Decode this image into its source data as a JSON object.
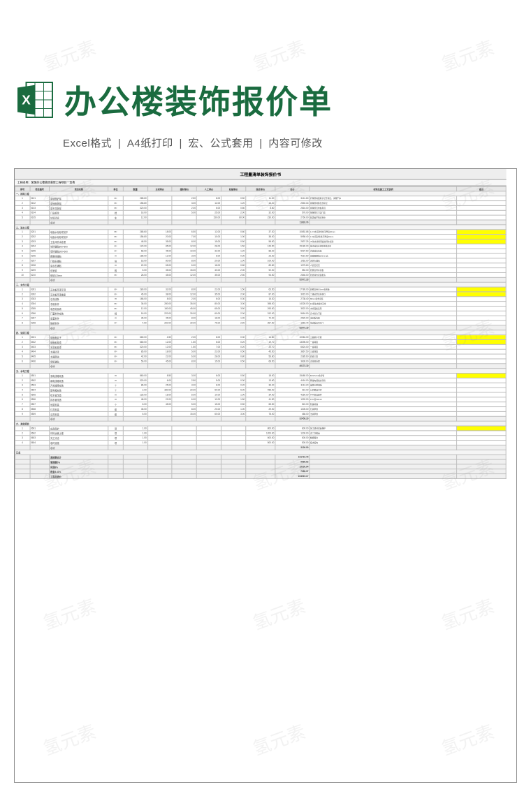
{
  "header": {
    "title": "办公楼装饰报价单",
    "subtitle_parts": [
      "Excel格式",
      "A4纸打印",
      "宏、公式套用",
      "内容可修改"
    ]
  },
  "watermark_text": "氢元素",
  "sheet": {
    "main_title": "工程量清单装饰报价书",
    "project_line": "工程名称：某某办公楼装饰装修工程项目一览表",
    "columns": [
      "序号",
      "项目编号",
      "项目名称",
      "单位",
      "数量",
      "主材单价",
      "辅材单价",
      "人工单价",
      "机械单价",
      "综合单价",
      "合价",
      "材料及施工工艺说明",
      "备注"
    ]
  },
  "sections": [
    {
      "name": "一、拆除工程",
      "rows": [
        [
          "1",
          "0101",
          "原墙面铲除",
          "m²",
          "285.60",
          "",
          "2.50",
          "8.00",
          "0.50",
          "11.00",
          "3141.60",
          "铲除原墙面腻子层至基层，清理干净",
          ""
        ],
        [
          "2",
          "0102",
          "原地面拆除",
          "m²",
          "156.80",
          "",
          "3.00",
          "12.00",
          "1.20",
          "16.20",
          "2540.16",
          "拆除原地砖及找平层",
          ""
        ],
        [
          "3",
          "0103",
          "原天花拆除",
          "m²",
          "320.00",
          "",
          "2.00",
          "6.00",
          "0.80",
          "8.80",
          "2816.00",
          "拆除原石膏板吊顶",
          ""
        ],
        [
          "4",
          "0104",
          "门窗拆除",
          "樘",
          "18.00",
          "",
          "5.00",
          "25.00",
          "2.00",
          "32.00",
          "576.00",
          "拆除原木门含门套",
          ""
        ],
        [
          "5",
          "0105",
          "垃圾清运",
          "车",
          "12.00",
          "",
          "",
          "150.00",
          "80.00",
          "230.00",
          "2760.00",
          "装袋运至指定地点",
          ""
        ],
        [
          "",
          "",
          "小计",
          "",
          "",
          "",
          "",
          "",
          "",
          "",
          "11833.76",
          "",
          ""
        ]
      ]
    },
    {
      "name": "二、泥水工程",
      "sep": "purple",
      "rows": [
        [
          "1",
          "0201",
          "墙面水泥砂浆找平",
          "m²",
          "285.60",
          "18.00",
          "6.50",
          "12.00",
          "0.80",
          "37.30",
          "10652.88",
          "1:2.5水泥砂浆找平厚度20mm",
          "hl"
        ],
        [
          "2",
          "0202",
          "地面水泥砂浆找平",
          "m²",
          "156.80",
          "20.00",
          "7.00",
          "10.00",
          "1.00",
          "38.00",
          "5958.40",
          "1:3水泥砂浆找平厚度30mm",
          "hl"
        ],
        [
          "3",
          "0203",
          "卫生间防水处理",
          "m²",
          "48.50",
          "35.00",
          "8.00",
          "15.00",
          "0.50",
          "58.50",
          "2837.25",
          "JS防水涂料两遍含闭水试验",
          "hl"
        ],
        [
          "4",
          "0204",
          "地砖铺贴800×800",
          "m²",
          "120.00",
          "85.00",
          "12.00",
          "28.00",
          "1.50",
          "126.50",
          "15180.00",
          "抛光砖含水泥砂浆结合层",
          ""
        ],
        [
          "5",
          "0205",
          "墙砖铺贴300×600",
          "m²",
          "68.00",
          "45.00",
          "10.00",
          "32.00",
          "1.20",
          "88.20",
          "5997.60",
          "内墙砖含勾缝",
          ""
        ],
        [
          "6",
          "0206",
          "踢脚线铺贴",
          "m",
          "185.00",
          "12.00",
          "3.00",
          "8.00",
          "0.30",
          "23.30",
          "4310.50",
          "瓷砖踢脚线100mm高",
          ""
        ],
        [
          "7",
          "0207",
          "门槛石铺贴",
          "块",
          "18.00",
          "80.00",
          "8.00",
          "20.00",
          "1.00",
          "109.00",
          "1962.00",
          "天然大理石",
          ""
        ],
        [
          "8",
          "0208",
          "窗台石铺贴",
          "m",
          "22.00",
          "65.00",
          "6.00",
          "18.00",
          "0.80",
          "89.80",
          "1975.60",
          "人造石英石",
          ""
        ],
        [
          "9",
          "0209",
          "包管道",
          "根",
          "6.00",
          "35.00",
          "15.00",
          "40.00",
          "2.00",
          "92.00",
          "552.00",
          "轻钢龙骨水泥板",
          ""
        ],
        [
          "10",
          "0210",
          "砌墙120mm",
          "m²",
          "28.00",
          "45.00",
          "12.00",
          "35.00",
          "2.50",
          "94.50",
          "2646.00",
          "轻质砖含双面批荡",
          ""
        ],
        [
          "",
          "",
          "小计",
          "",
          "",
          "",
          "",
          "",
          "",
          "",
          "52072.23",
          "",
          ""
        ]
      ]
    },
    {
      "name": "三、木作工程",
      "sep": "purple",
      "rows": [
        [
          "1",
          "0301",
          "石膏板吊顶平顶",
          "m²",
          "280.00",
          "32.00",
          "8.00",
          "22.00",
          "1.50",
          "63.50",
          "17780.00",
          "轻钢龙骨9.5mm石膏板",
          "hl"
        ],
        [
          "2",
          "0302",
          "石膏板吊顶造型",
          "m²",
          "45.00",
          "38.00",
          "12.00",
          "35.00",
          "2.00",
          "87.00",
          "3915.00",
          "二级造型含检修口",
          "hl"
        ],
        [
          "3",
          "0303",
          "石膏线条",
          "m",
          "168.00",
          "8.00",
          "2.00",
          "6.00",
          "0.30",
          "16.30",
          "2738.40",
          "80mm宽含安装",
          ""
        ],
        [
          "4",
          "0304",
          "衣柜制作",
          "m²",
          "36.00",
          "280.00",
          "35.00",
          "80.00",
          "3.00",
          "398.00",
          "14328.00",
          "E1级生态板含五金",
          ""
        ],
        [
          "5",
          "0305",
          "电视背景墙",
          "m²",
          "12.00",
          "180.00",
          "45.00",
          "65.00",
          "3.50",
          "293.50",
          "3522.00",
          "木饰面板造型",
          ""
        ],
        [
          "6",
          "0306",
          "门套制作安装",
          "樘",
          "18.00",
          "220.00",
          "30.00",
          "60.00",
          "2.00",
          "312.00",
          "5616.00",
          "实木复合门套",
          ""
        ],
        [
          "7",
          "0307",
          "窗套制作",
          "m",
          "35.00",
          "45.00",
          "8.00",
          "18.00",
          "1.00",
          "72.00",
          "2520.00",
          "多层板饰面",
          ""
        ],
        [
          "8",
          "0308",
          "鞋柜制作",
          "m²",
          "4.50",
          "260.00",
          "30.00",
          "75.00",
          "2.50",
          "367.50",
          "1653.75",
          "生态板含百叶门",
          ""
        ],
        [
          "",
          "",
          "小计",
          "",
          "",
          "",
          "",
          "",
          "",
          "",
          "52073.15",
          "",
          ""
        ]
      ]
    },
    {
      "name": "四、油漆工程",
      "sep": "purple",
      "rows": [
        [
          "1",
          "0401",
          "墙面批腻子",
          "m²",
          "680.00",
          "4.50",
          "2.00",
          "8.00",
          "0.30",
          "14.80",
          "10064.00",
          "三遍腻子打磨",
          "hl"
        ],
        [
          "2",
          "0402",
          "墙面乳胶漆",
          "m²",
          "680.00",
          "12.00",
          "1.50",
          "6.00",
          "0.20",
          "19.70",
          "13396.00",
          "一底两面",
          "hl"
        ],
        [
          "3",
          "0403",
          "天花乳胶漆",
          "m²",
          "320.00",
          "12.00",
          "1.50",
          "7.00",
          "0.20",
          "20.70",
          "6624.00",
          "一底两面",
          ""
        ],
        [
          "4",
          "0404",
          "木器清漆",
          "m²",
          "85.00",
          "18.00",
          "5.00",
          "22.00",
          "0.50",
          "45.50",
          "3867.50",
          "三底两面",
          ""
        ],
        [
          "5",
          "0405",
          "木器混油",
          "m²",
          "42.00",
          "22.00",
          "6.00",
          "28.00",
          "0.80",
          "56.80",
          "2385.60",
          "四底三面",
          ""
        ],
        [
          "6",
          "0406",
          "墙纸铺贴",
          "m²",
          "56.00",
          "45.00",
          "8.00",
          "15.00",
          "0.50",
          "68.50",
          "3836.00",
          "含基膜处理",
          ""
        ],
        [
          "",
          "",
          "小计",
          "",
          "",
          "",
          "",
          "",
          "",
          "",
          "40173.10",
          "",
          ""
        ]
      ]
    },
    {
      "name": "五、水电工程",
      "sep": "purple",
      "rows": [
        [
          "1",
          "0501",
          "强电线路改造",
          "m",
          "860.00",
          "8.50",
          "3.00",
          "6.00",
          "0.50",
          "18.00",
          "15480.00",
          "BV2.5/4.0含穿管",
          "hl"
        ],
        [
          "2",
          "0502",
          "弱电线路改造",
          "m",
          "320.00",
          "6.00",
          "2.50",
          "5.00",
          "0.30",
          "13.80",
          "4416.00",
          "网线电视线含穿管",
          ""
        ],
        [
          "3",
          "0503",
          "开关插座安装",
          "个",
          "86.00",
          "25.00",
          "3.00",
          "8.00",
          "0.20",
          "36.20",
          "3113.20",
          "品牌86型面板",
          ""
        ],
        [
          "4",
          "0504",
          "配电箱安装",
          "个",
          "2.00",
          "380.00",
          "20.00",
          "50.00",
          "5.00",
          "455.00",
          "910.00",
          "12回路含空开",
          ""
        ],
        [
          "5",
          "0505",
          "给水管改造",
          "m",
          "125.00",
          "18.00",
          "5.00",
          "10.00",
          "1.00",
          "34.00",
          "4250.00",
          "PPR管含配件",
          ""
        ],
        [
          "6",
          "0506",
          "排水管改造",
          "m",
          "48.00",
          "22.00",
          "6.00",
          "12.00",
          "1.50",
          "41.50",
          "1992.00",
          "PVC管50/110",
          ""
        ],
        [
          "7",
          "0507",
          "地漏安装",
          "个",
          "8.00",
          "45.00",
          "5.00",
          "15.00",
          "0.50",
          "65.50",
          "524.00",
          "防臭地漏",
          ""
        ],
        [
          "8",
          "0508",
          "灯具安装",
          "套",
          "45.00",
          "",
          "8.00",
          "20.00",
          "1.00",
          "29.00",
          "1305.00",
          "灯具甲供",
          ""
        ],
        [
          "9",
          "0509",
          "洁具安装",
          "套",
          "6.00",
          "",
          "15.00",
          "60.00",
          "3.00",
          "78.00",
          "468.00",
          "洁具甲供",
          ""
        ],
        [
          "",
          "",
          "小计",
          "",
          "",
          "",
          "",
          "",
          "",
          "",
          "32458.20",
          "",
          ""
        ]
      ]
    },
    {
      "name": "六、其他项目",
      "sep": "purple",
      "rows": [
        [
          "1",
          "0601",
          "成品保护",
          "项",
          "1.00",
          "",
          "",
          "",
          "",
          "800.00",
          "800.00",
          "施工期间成品保护",
          "hl"
        ],
        [
          "2",
          "0602",
          "材料运输上楼",
          "项",
          "1.00",
          "",
          "",
          "",
          "",
          "1200.00",
          "1200.00",
          "含二次搬运",
          ""
        ],
        [
          "3",
          "0603",
          "完工清洁",
          "项",
          "1.00",
          "",
          "",
          "",
          "",
          "600.00",
          "600.00",
          "精细保洁",
          ""
        ],
        [
          "4",
          "0604",
          "临时设施",
          "项",
          "1.00",
          "",
          "",
          "",
          "",
          "500.00",
          "500.00",
          "临水临电",
          ""
        ],
        [
          "",
          "",
          "小计",
          "",
          "",
          "",
          "",
          "",
          "",
          "",
          "3100.00",
          "",
          ""
        ]
      ]
    },
    {
      "name": "汇总",
      "sep": "teal",
      "rows": [
        [
          "",
          "",
          "直接费合计",
          "",
          "",
          "",
          "",
          "",
          "",
          "",
          "191710.44",
          "",
          ""
        ],
        [
          "",
          "",
          "管理费5%",
          "",
          "",
          "",
          "",
          "",
          "",
          "",
          "9585.52",
          "",
          ""
        ],
        [
          "",
          "",
          "利润8%",
          "",
          "",
          "",
          "",
          "",
          "",
          "",
          "15336.84",
          "",
          ""
        ],
        [
          "",
          "",
          "税金3.41%",
          "",
          "",
          "",
          "",
          "",
          "",
          "",
          "7386.37",
          "",
          ""
        ],
        [
          "",
          "",
          "工程总造价",
          "",
          "",
          "",
          "",
          "",
          "",
          "",
          "224019.17",
          "",
          ""
        ]
      ]
    }
  ]
}
